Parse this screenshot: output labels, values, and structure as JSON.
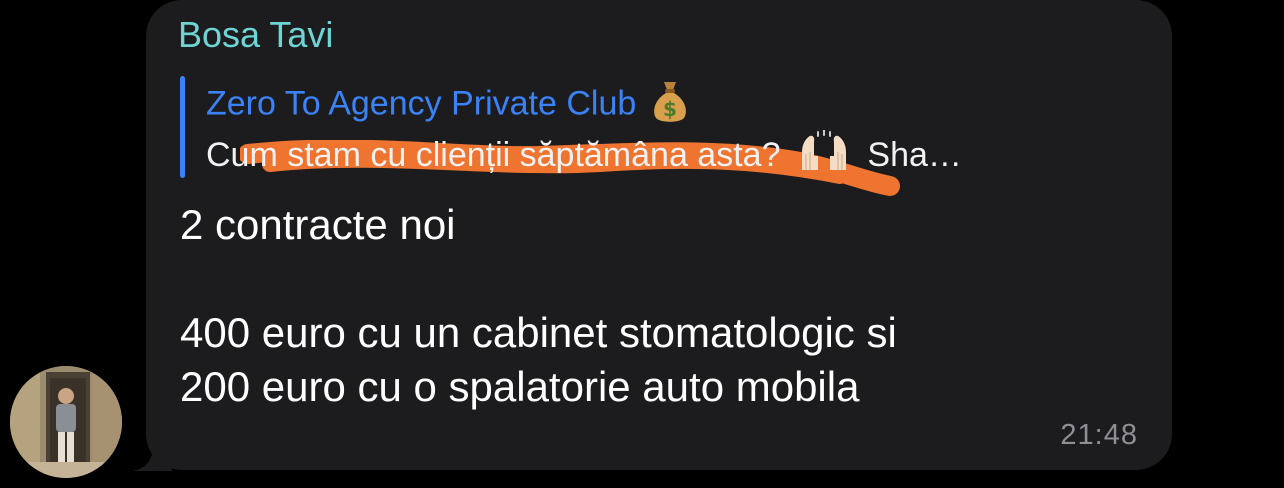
{
  "chat": {
    "sender_name": "Bosa Tavi",
    "reply": {
      "title": "Zero To Agency Private Club",
      "title_emoji": "money-bag",
      "preview_text_before": "Cum stam cu clienții săptămâna asta?",
      "preview_emoji": "raised-hands",
      "preview_text_after": "Sha…"
    },
    "message_lines": [
      "2 contracte noi",
      "",
      "400 euro cu un cabinet stomatologic si",
      "200 euro cu o spalatorie auto mobila"
    ],
    "timestamp": "21:48"
  },
  "colors": {
    "background": "#000000",
    "bubble": "#1c1c1e",
    "sender_name": "#6ed4d4",
    "reply_accent": "#3b82f6",
    "message_text": "#ffffff",
    "timestamp": "#8e8e93",
    "redaction_scribble": "#ef7430"
  }
}
